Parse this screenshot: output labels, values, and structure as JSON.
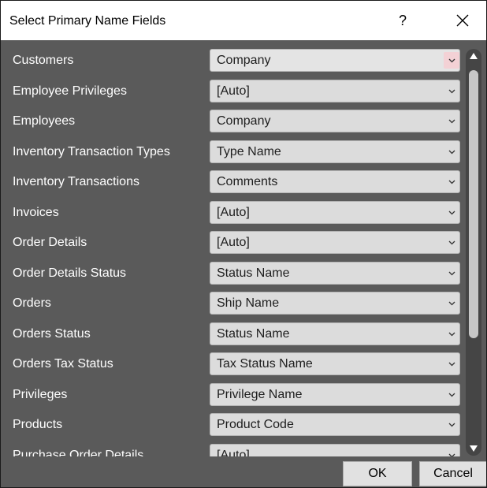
{
  "dialog": {
    "title": "Select Primary Name Fields",
    "help_label": "?",
    "close_icon": "close-icon"
  },
  "rows": [
    {
      "label": "Customers",
      "value": "Company",
      "focused": true
    },
    {
      "label": "Employee Privileges",
      "value": "[Auto]"
    },
    {
      "label": "Employees",
      "value": "Company"
    },
    {
      "label": "Inventory Transaction Types",
      "value": "Type Name"
    },
    {
      "label": "Inventory Transactions",
      "value": "Comments"
    },
    {
      "label": "Invoices",
      "value": "[Auto]"
    },
    {
      "label": "Order Details",
      "value": "[Auto]"
    },
    {
      "label": "Order Details Status",
      "value": "Status Name"
    },
    {
      "label": "Orders",
      "value": "Ship Name"
    },
    {
      "label": "Orders Status",
      "value": "Status Name"
    },
    {
      "label": "Orders Tax Status",
      "value": "Tax Status Name"
    },
    {
      "label": "Privileges",
      "value": "Privilege Name"
    },
    {
      "label": "Products",
      "value": "Product Code"
    },
    {
      "label": "Purchase Order Details",
      "value": "[Auto]"
    }
  ],
  "buttons": {
    "ok_label": "OK",
    "cancel_label": "Cancel"
  },
  "colors": {
    "dialog_bg": "#5a5a5a",
    "select_bg": "#dcdcdc",
    "focused_chevron_bg": "#f3d1d5",
    "scrollbar_track": "#454545",
    "scrollbar_thumb": "#c7c7c7"
  }
}
